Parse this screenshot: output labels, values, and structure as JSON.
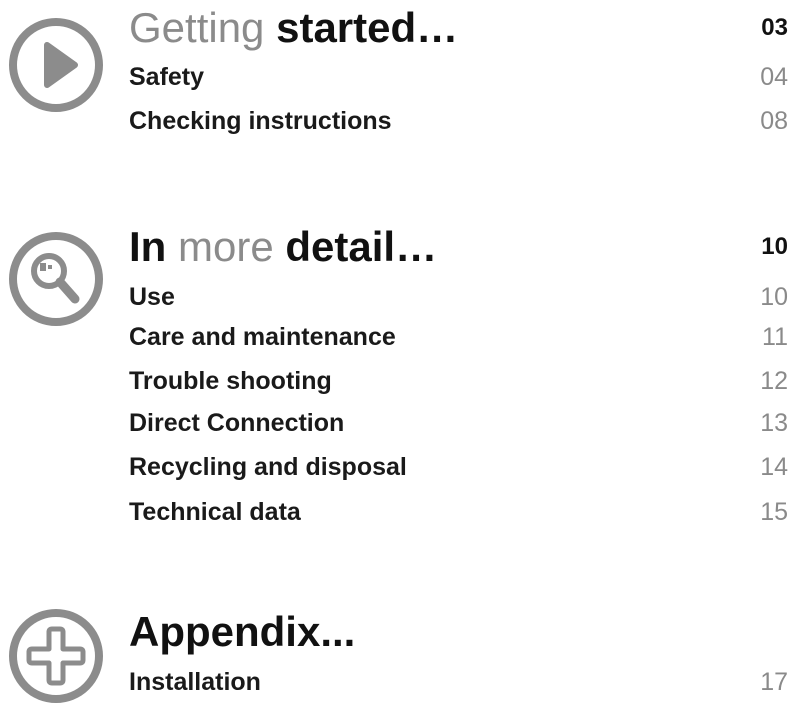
{
  "sections": [
    {
      "icon": "play-icon",
      "title_light": "Getting",
      "title_bold": "started…",
      "page": "03",
      "entries": [
        {
          "label": "Safety",
          "page": "04"
        },
        {
          "label": "Checking instructions",
          "page": "08"
        }
      ]
    },
    {
      "icon": "magnifier-icon",
      "title_bold_1": "In",
      "title_light": "more",
      "title_bold_2": "detail…",
      "page": "10",
      "entries": [
        {
          "label": "Use",
          "page": "10"
        },
        {
          "label": "Care and maintenance",
          "page": "11"
        },
        {
          "label": "Trouble shooting",
          "page": "12"
        },
        {
          "label": "Direct Connection",
          "page": "13"
        },
        {
          "label": "Recycling and disposal",
          "page": "14"
        },
        {
          "label": "Technical data",
          "page": "15"
        }
      ]
    },
    {
      "icon": "plus-icon",
      "title_bold": "Appendix...",
      "entries": [
        {
          "label": "Installation",
          "page": "17"
        }
      ]
    }
  ],
  "colors": {
    "icon_gray": "#8c8c8c",
    "page_gray": "#8a8a8a",
    "text_dark": "#1a1a1a"
  }
}
